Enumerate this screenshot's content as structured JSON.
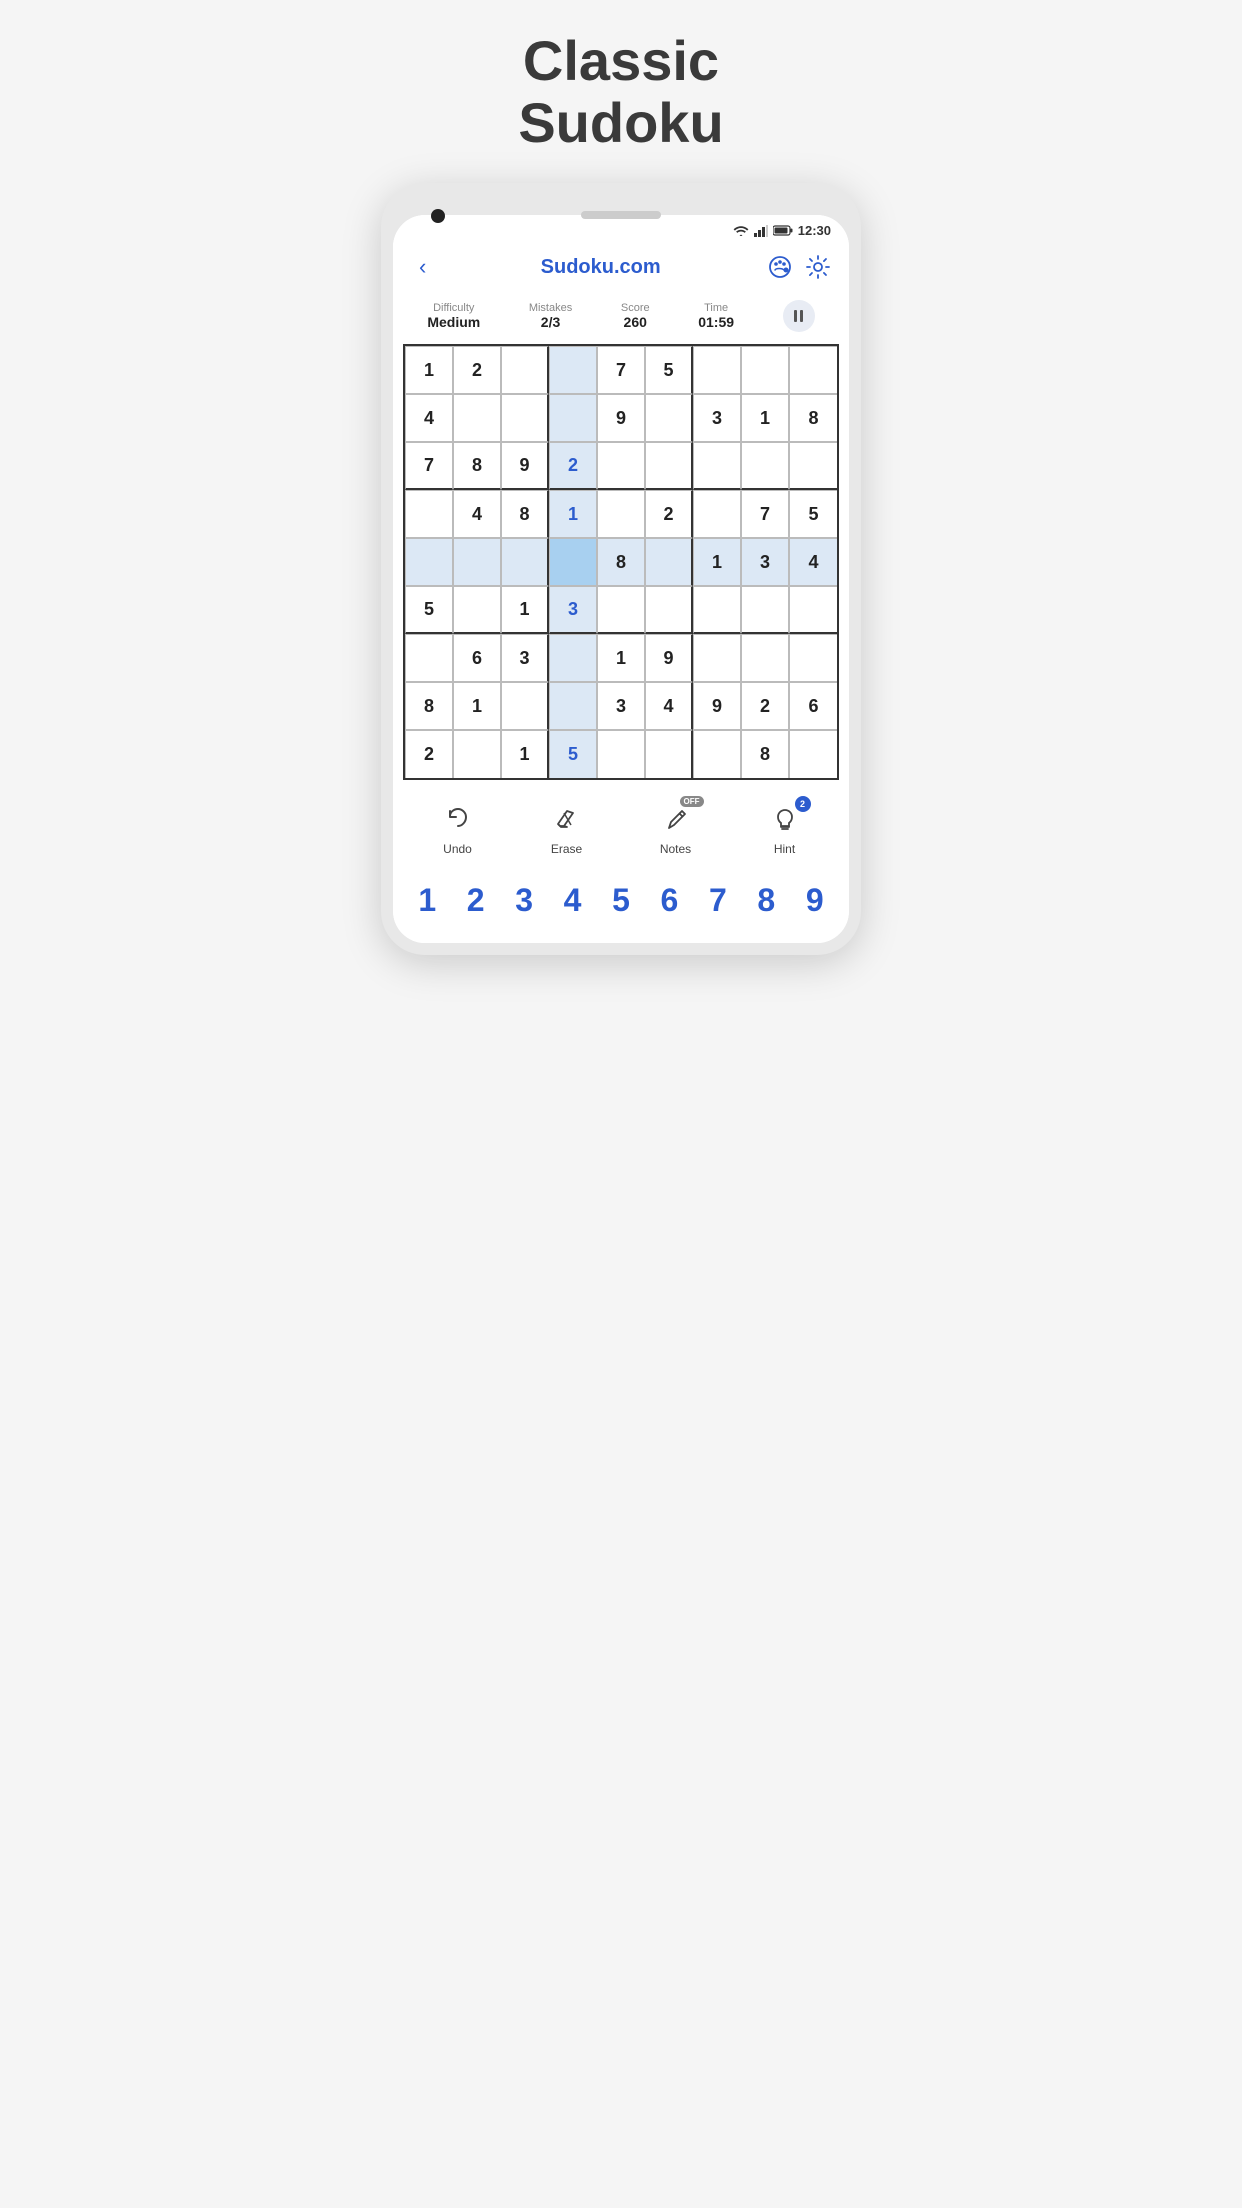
{
  "page": {
    "title_line1": "Classic",
    "title_line2": "Sudoku"
  },
  "status_bar": {
    "time": "12:30"
  },
  "header": {
    "back_label": "‹",
    "title": "Sudoku.com"
  },
  "stats": {
    "difficulty_label": "Difficulty",
    "difficulty_value": "Medium",
    "mistakes_label": "Mistakes",
    "mistakes_value": "2/3",
    "score_label": "Score",
    "score_value": "260",
    "time_label": "Time",
    "time_value": "01:59"
  },
  "toolbar": {
    "undo_label": "Undo",
    "erase_label": "Erase",
    "notes_label": "Notes",
    "notes_badge": "OFF",
    "hint_label": "Hint",
    "hint_badge": "2"
  },
  "numbers": [
    "1",
    "2",
    "3",
    "4",
    "5",
    "6",
    "7",
    "8",
    "9"
  ],
  "grid": [
    [
      "1",
      "2",
      "",
      "",
      "7",
      "5",
      "",
      "",
      ""
    ],
    [
      "4",
      "",
      "",
      "",
      "9",
      "",
      "3",
      "1",
      "8"
    ],
    [
      "7",
      "8",
      "9",
      "2",
      "",
      "",
      "",
      "",
      ""
    ],
    [
      "",
      "4",
      "8",
      "1",
      "",
      "2",
      "",
      "7",
      "5"
    ],
    [
      "",
      "",
      "",
      "",
      "8",
      "",
      "1",
      "3",
      "4"
    ],
    [
      "5",
      "",
      "1",
      "3",
      "",
      "",
      "",
      "",
      ""
    ],
    [
      "",
      "6",
      "3",
      "",
      "1",
      "9",
      "",
      "",
      ""
    ],
    [
      "8",
      "1",
      "",
      "",
      "3",
      "4",
      "9",
      "2",
      "6"
    ],
    [
      "2",
      "",
      "1",
      "5",
      "",
      "",
      "",
      "8",
      ""
    ]
  ],
  "cell_types": [
    [
      "preset",
      "preset",
      "empty",
      "highlight-col",
      "preset",
      "preset",
      "empty",
      "empty",
      "empty"
    ],
    [
      "preset",
      "empty",
      "empty",
      "highlight-col",
      "preset",
      "empty",
      "preset",
      "preset",
      "preset"
    ],
    [
      "preset",
      "preset",
      "preset",
      "user",
      "empty",
      "empty",
      "empty",
      "empty",
      "empty"
    ],
    [
      "empty",
      "preset",
      "preset",
      "user-selected",
      "empty",
      "preset",
      "empty",
      "preset",
      "preset"
    ],
    [
      "highlight-row",
      "highlight-row",
      "highlight-row",
      "selected",
      "preset",
      "empty",
      "preset",
      "preset",
      "preset"
    ],
    [
      "preset",
      "empty",
      "preset",
      "user",
      "empty",
      "empty",
      "empty",
      "empty",
      "empty"
    ],
    [
      "empty",
      "preset",
      "preset",
      "highlight-col",
      "preset",
      "preset",
      "empty",
      "empty",
      "empty"
    ],
    [
      "preset",
      "preset",
      "empty",
      "highlight-col",
      "preset",
      "preset",
      "preset",
      "preset",
      "preset"
    ],
    [
      "preset",
      "empty",
      "preset",
      "user",
      "empty",
      "empty",
      "empty",
      "preset",
      "empty"
    ]
  ]
}
